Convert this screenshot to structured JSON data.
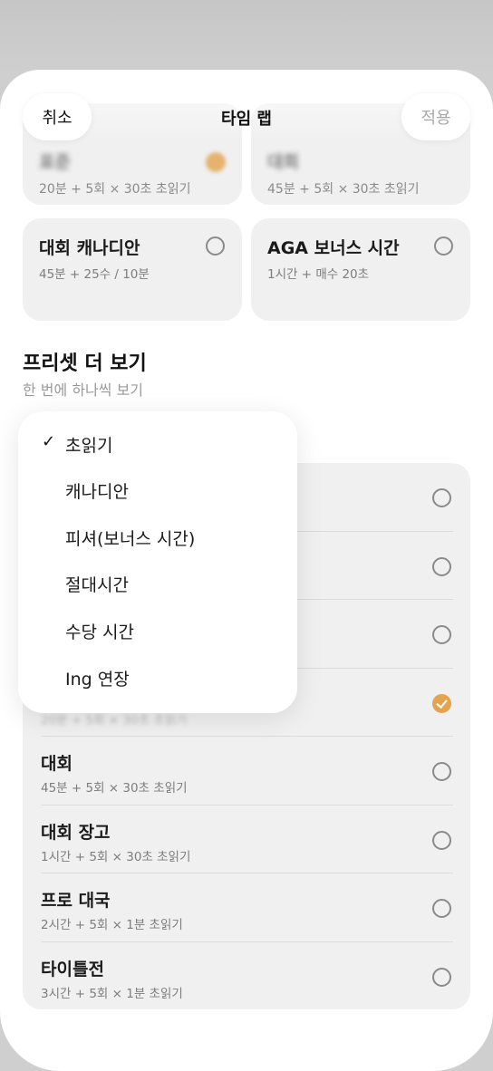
{
  "header": {
    "cancel_label": "취소",
    "title": "타임 랩",
    "apply_label": "적용"
  },
  "top_cards": [
    {
      "title": "표준",
      "subtitle": "20분 + 5회 × 30초 초읽기",
      "selected": true
    },
    {
      "title": "대회",
      "subtitle": "45분 + 5회 × 30초 초읽기",
      "selected": false
    }
  ],
  "cards": [
    {
      "title": "대회 캐나디안",
      "subtitle": "45분 + 25수 / 10분"
    },
    {
      "title": "AGA 보너스 시간",
      "subtitle": "1시간 + 매수 20초"
    }
  ],
  "section": {
    "title": "프리셋 더 보기",
    "subtitle": "한 번에 하나씩 보기"
  },
  "list": [
    {
      "title": "",
      "subtitle": "",
      "selected": false
    },
    {
      "title": "",
      "subtitle": "",
      "selected": false
    },
    {
      "title": "",
      "subtitle": "",
      "selected": false
    },
    {
      "title": "",
      "subtitle": "20분 + 5회 × 30초 초읽기",
      "selected": true
    },
    {
      "title": "대회",
      "subtitle": "45분 + 5회 × 30초 초읽기",
      "selected": false
    },
    {
      "title": "대회 장고",
      "subtitle": "1시간 + 5회 × 30초 초읽기",
      "selected": false
    },
    {
      "title": "프로 대국",
      "subtitle": "2시간 + 5회 × 1분 초읽기",
      "selected": false
    },
    {
      "title": "타이틀전",
      "subtitle": "3시간 + 5회 × 1분 초읽기",
      "selected": false
    }
  ],
  "menu": {
    "check_glyph": "✓",
    "items": [
      {
        "label": "초읽기",
        "checked": true
      },
      {
        "label": "캐나디안",
        "checked": false
      },
      {
        "label": "피셔(보너스 시간)",
        "checked": false
      },
      {
        "label": "절대시간",
        "checked": false
      },
      {
        "label": "수당 시간",
        "checked": false
      },
      {
        "label": "Ing 연장",
        "checked": false
      }
    ]
  },
  "colors": {
    "accent": "#e3a34f",
    "card_bg": "#f0f0f0"
  }
}
